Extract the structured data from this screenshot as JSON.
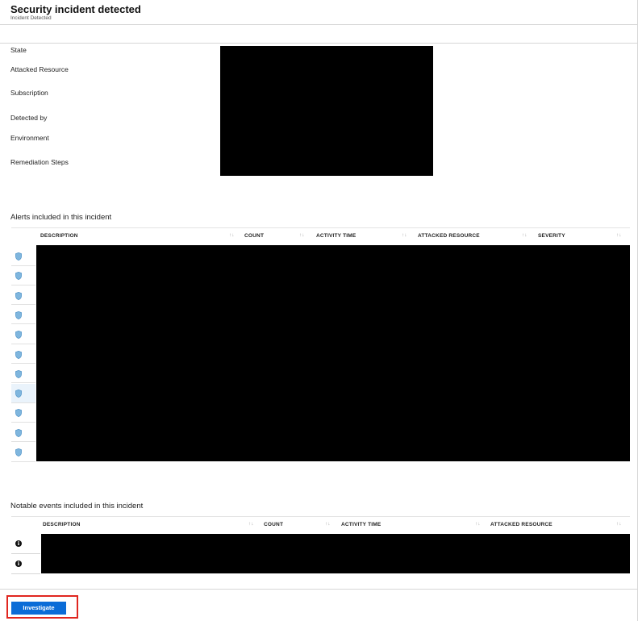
{
  "header": {
    "title": "Security incident detected",
    "subtitle": "Incident Detected"
  },
  "properties": {
    "labels": [
      "State",
      "Attacked Resource",
      "Subscription",
      "Detected by",
      "Environment",
      "Remediation Steps"
    ]
  },
  "alerts": {
    "title": "Alerts included in this incident",
    "columns": [
      "DESCRIPTION",
      "COUNT",
      "ACTIVITY TIME",
      "ATTACKED RESOURCE",
      "SEVERITY"
    ],
    "row_icon": "shield-icon",
    "row_count": 11,
    "selected_row": 7
  },
  "events": {
    "title": "Notable events included in this incident",
    "columns": [
      "DESCRIPTION",
      "COUNT",
      "ACTIVITY TIME",
      "ATTACKED RESOURCE"
    ],
    "row_icon": "info-icon",
    "row_count": 2
  },
  "footer": {
    "investigate_label": "Investigate"
  },
  "colors": {
    "accent": "#0b6cd7",
    "highlight": "#e0261f",
    "selected_row": "#eaf3fb",
    "shield": "#7fb6de"
  },
  "sort_glyph": "↑↓"
}
